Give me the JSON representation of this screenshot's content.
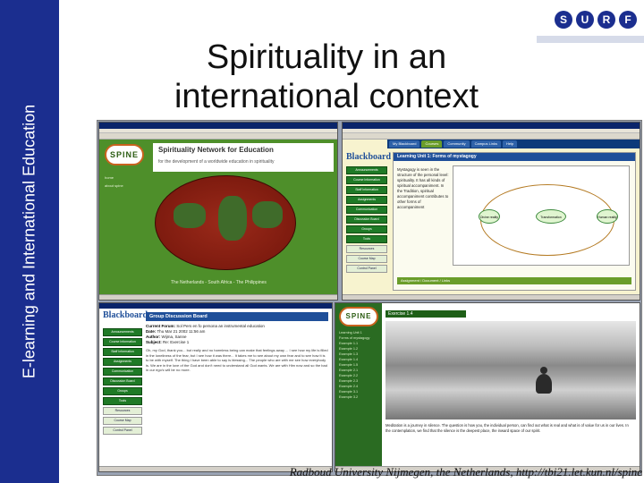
{
  "sidebar": {
    "title": "E-learning and International Education"
  },
  "logo": {
    "letters": [
      "S",
      "U",
      "R",
      "F"
    ]
  },
  "slide": {
    "title": "Spirituality in an international context",
    "footer": "Radboud University Nijmegen, the Netherlands, http://tbi21.let.kun.nl/spine"
  },
  "colors": {
    "band": "#1b2e8f",
    "spine_green": "#4e8f2a",
    "blackboard_blue": "#1f4f99"
  },
  "win1": {
    "logo": "SPINE",
    "heading": "Spirituality Network for Education",
    "subheading": "for the development of a worldwide education in spirituality",
    "nav": [
      "home",
      "about spine"
    ],
    "caption": "The Netherlands - South Africa - The Philippines"
  },
  "win2": {
    "tabs": [
      "My Blackboard",
      "Courses",
      "Community",
      "Campus Links",
      "Help"
    ],
    "logo": "Blackboard",
    "menu": [
      "Announcements",
      "Course Information",
      "Staff Information",
      "Assignments",
      "Communication",
      "Discussion Board",
      "Groups",
      "Tools",
      "Resources",
      "Course Map",
      "Control Panel"
    ],
    "content_heading": "Learning Unit 1: Forms of mystagogy",
    "content_text": "Mystagogy is seen in the structure of the personal level: spirituality. It has all kinds of spiritual accompaniment. In the Tradition, spiritual accompaniment contributes to other forms of accompaniment",
    "diagram_nodes": [
      "Divine reality",
      "Transformation",
      "Human reality"
    ],
    "table_header": "Assignment / Document / Links"
  },
  "win3": {
    "logo": "Blackboard",
    "menu": [
      "Announcements",
      "Course Information",
      "Staff Information",
      "Assignments",
      "Communication",
      "Discussion Board",
      "Groups",
      "Tools",
      "Resources",
      "Course Map",
      "Control Panel"
    ],
    "heading": "Group Discussion Board",
    "current_forum_label": "Current Forum:",
    "current_forum": "Sol Pers en fo persona an instrumental education",
    "date_label": "Date:",
    "date": "Thu Mar 21 2002 11:56 am",
    "author_label": "Author:",
    "author": "Wijma, Sanne",
    "subject_label": "Subject:",
    "subject": "Re: Exercise 1",
    "message": "Oh, my God, thank you... but really and no harmless being can make that feelings away ... I see how my life is filled in the loneliness of the fear, but I see how it was there... It takes me to see about my own fear and to see how it is to be with myself. The thing I have been able to say is blessing... The people who are with me see how everybody is. We are in the love of the God and don't need to understand all God wants. We are with Him now and so the bad in our ego's will be no more."
  },
  "win4": {
    "logo": "SPINE",
    "links": [
      "Learning Unit 1",
      "Forms of mystagogy",
      "Example 1.1",
      "Example 1.2",
      "Example 1.3",
      "Example 1.4",
      "Example 1.5",
      "Example 2.1",
      "Example 2.2",
      "Example 2.3",
      "Example 2.4",
      "Example 3.1",
      "Example 3.2"
    ],
    "exercise_label": "Exercise 1.4",
    "text": "Meditation is a journey in silence. The question is how you, the individual person, can find out what is real and what is of value for us in our lives. In the contemplation, we find that the silence is the deepest place, the inward space of our spirit."
  }
}
